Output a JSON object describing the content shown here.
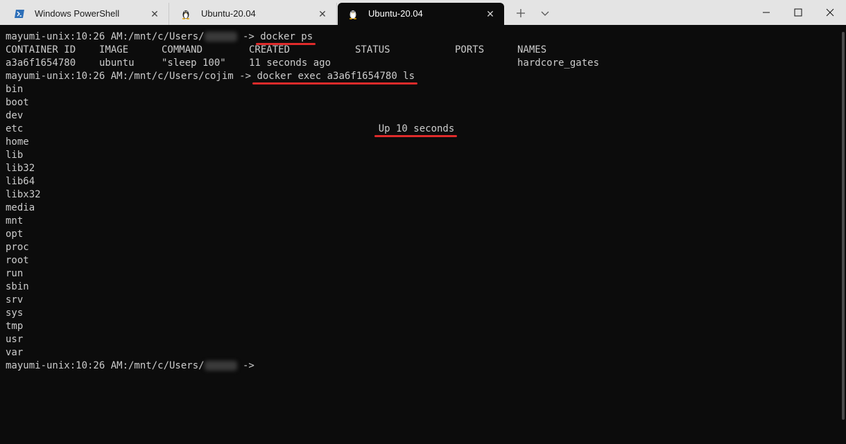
{
  "tabs": [
    {
      "label": "Windows PowerShell",
      "icon": "powershell-icon",
      "active": false
    },
    {
      "label": "Ubuntu-20.04",
      "icon": "tux-icon",
      "active": false
    },
    {
      "label": "Ubuntu-20.04",
      "icon": "tux-icon",
      "active": true
    }
  ],
  "colors": {
    "terminal_bg": "#0c0c0c",
    "terminal_fg": "#cccccc",
    "tabbar_bg": "#e4e4e4",
    "highlight": "#e02b2b",
    "powershell": "#2d6fb8"
  },
  "terminal": {
    "prompt": "mayumi-unix:10:26 AM:/mnt/c/Users/",
    "prompt_user_visible": "cojim",
    "arrow": " -> ",
    "cmd1": "docker ps",
    "headers": {
      "container_id": "CONTAINER ID",
      "image": "IMAGE",
      "command": "COMMAND",
      "created": "CREATED",
      "status": "STATUS",
      "ports": "PORTS",
      "names": "NAMES"
    },
    "row": {
      "container_id": "a3a6f1654780",
      "image": "ubuntu",
      "command": "\"sleep 100\"",
      "created": "11 seconds ago",
      "status": "Up 10 seconds",
      "ports": "",
      "names": "hardcore_gates"
    },
    "cmd2": "docker exec a3a6f1654780 ls",
    "ls_output": [
      "bin",
      "boot",
      "dev",
      "etc",
      "home",
      "lib",
      "lib32",
      "lib64",
      "libx32",
      "media",
      "mnt",
      "opt",
      "proc",
      "root",
      "run",
      "sbin",
      "srv",
      "sys",
      "tmp",
      "usr",
      "var"
    ]
  }
}
